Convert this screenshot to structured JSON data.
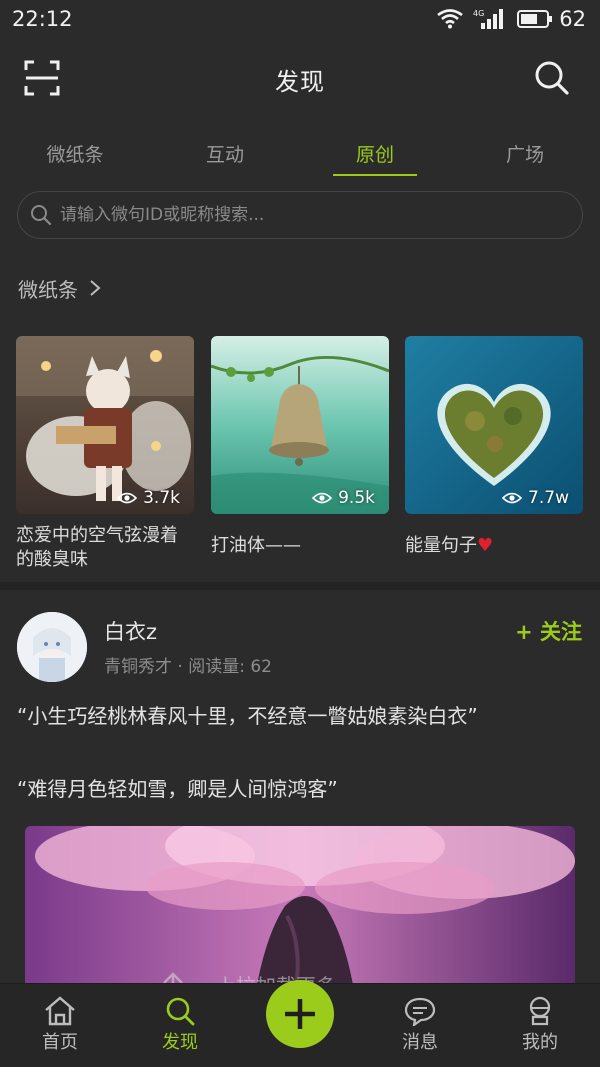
{
  "status_bar": {
    "time": "22:12",
    "network": "4G",
    "battery": "62"
  },
  "header": {
    "title": "发现"
  },
  "tabs": [
    {
      "label": "微纸条",
      "active": false
    },
    {
      "label": "互动",
      "active": false
    },
    {
      "label": "原创",
      "active": true
    },
    {
      "label": "广场",
      "active": false
    }
  ],
  "search": {
    "placeholder": "请输入微句ID或昵称搜索..."
  },
  "section": {
    "title": "微纸条"
  },
  "cards": [
    {
      "views": "3.7k",
      "title": "恋爱中的空气弦漫着的酸臭味"
    },
    {
      "views": "9.5k",
      "title": "打油体——"
    },
    {
      "views": "7.7w",
      "title": "能量句子",
      "emoji": "♥"
    }
  ],
  "post": {
    "username": "白衣z",
    "meta": "青铜秀才 · 阅读量: 62",
    "follow": "+ 关注",
    "lines": [
      "“小生巧经桃林春风十里，不经意一瞥姑娘素染白衣”",
      "“难得月色轻如雪，卿是人间惊鸿客”"
    ],
    "pull_hint": "上拉加载更多"
  },
  "bottom_nav": [
    {
      "label": "首页",
      "icon": "home-icon",
      "active": false
    },
    {
      "label": "发现",
      "icon": "discover-icon",
      "active": true
    },
    {
      "label": "",
      "icon": "plus-icon",
      "active": false
    },
    {
      "label": "消息",
      "icon": "message-icon",
      "active": false
    },
    {
      "label": "我的",
      "icon": "profile-icon",
      "active": false
    }
  ],
  "colors": {
    "accent": "#9ccc1b",
    "background": "#2b2b2b"
  }
}
